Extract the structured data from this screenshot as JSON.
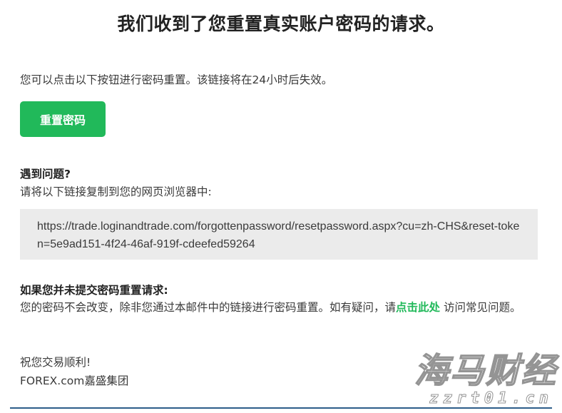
{
  "email": {
    "title": "我们收到了您重置真实账户密码的请求。",
    "intro": "您可以点击以下按钮进行密码重置。该链接将在24小时后失效。",
    "reset_button_label": "重置密码",
    "trouble_heading": "遇到问题?",
    "trouble_text": "请将以下链接复制到您的网页浏览器中:",
    "reset_link": "https://trade.loginandtrade.com/forgottenpassword/resetpassword.aspx?cu=zh-CHS&reset-token=5e9ad151-4f24-46af-919f-cdeefed59264",
    "not_requested_heading": "如果您并未提交密码重置请求:",
    "not_requested_text_before": "您的密码不会改变，除非您通过本邮件中的链接进行密码重置。如有疑问，请",
    "not_requested_link": "点击此处",
    "not_requested_text_after": " 访问常见问题。",
    "closing": "祝您交易顺利!",
    "signature": "FOREX.com嘉盛集团"
  },
  "watermark": {
    "chinese": "海马财经",
    "url": "zzrt01.cn"
  },
  "colors": {
    "accent_green": "#21b95a",
    "link_box_bg": "#ebebeb",
    "rule_blue": "#2d5d8a"
  }
}
